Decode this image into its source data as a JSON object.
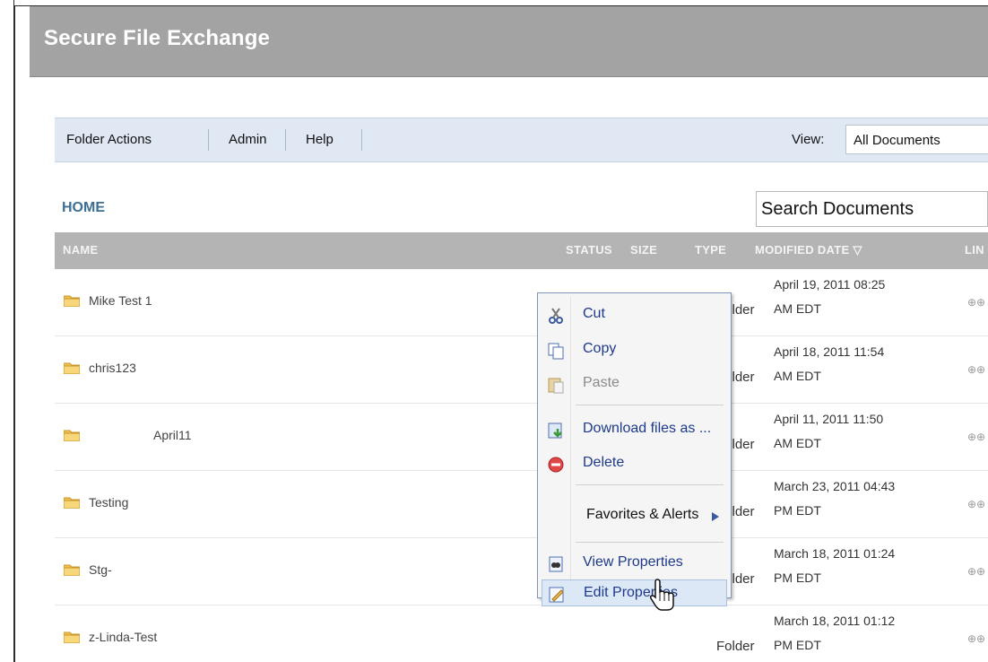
{
  "app": {
    "title": "Secure File Exchange"
  },
  "menubar": {
    "items": [
      "Folder Actions",
      "Admin",
      "Help"
    ],
    "view_label": "View:",
    "view_value": "All Documents"
  },
  "breadcrumb": "HOME",
  "search": {
    "placeholder": "Search Documents"
  },
  "table": {
    "headers": {
      "name": "NAME",
      "status": "STATUS",
      "size": "SIZE",
      "type": "TYPE",
      "modified": "MODIFIED DATE ▽",
      "link": "LIN"
    },
    "rows": [
      {
        "name": "Mike Test 1",
        "type": "Folder",
        "date1": "April 19, 2011 08:25",
        "date2": "AM EDT"
      },
      {
        "name": "chris123",
        "type": "Folder",
        "date1": "April 18, 2011 11:54",
        "date2": "AM EDT"
      },
      {
        "name": "April11",
        "type": "Folder",
        "date1": "April 11, 2011 11:50",
        "date2": "AM EDT"
      },
      {
        "name": "Testing",
        "type": "Folder",
        "date1": "March 23, 2011 04:43",
        "date2": "PM EDT"
      },
      {
        "name": "Stg-",
        "type": "Folder",
        "date1": "March 18, 2011 01:24",
        "date2": "PM EDT"
      },
      {
        "name": "z-Linda-Test",
        "type": "Folder",
        "date1": "March 18, 2011 01:12",
        "date2": "PM EDT"
      }
    ]
  },
  "context_menu": {
    "cut": "Cut",
    "copy": "Copy",
    "paste": "Paste",
    "download": "Download files as ...",
    "delete": "Delete",
    "favorites": "Favorites & Alerts",
    "view_properties": "View Properties",
    "edit_properties": "Edit Properties"
  },
  "colors": {
    "titlebar": "#a3a3a3",
    "menubar": "#dfe8f3",
    "header": "#b4b4b4",
    "menu_text": "#1e3a8a",
    "breadcrumb": "#3d6f93"
  },
  "icons": [
    "folder-icon",
    "link-icon",
    "scissors-icon",
    "copy-icon",
    "paste-icon",
    "download-icon",
    "delete-icon",
    "submenu-arrow-icon",
    "properties-icon",
    "edit-icon",
    "hand-cursor-icon"
  ]
}
